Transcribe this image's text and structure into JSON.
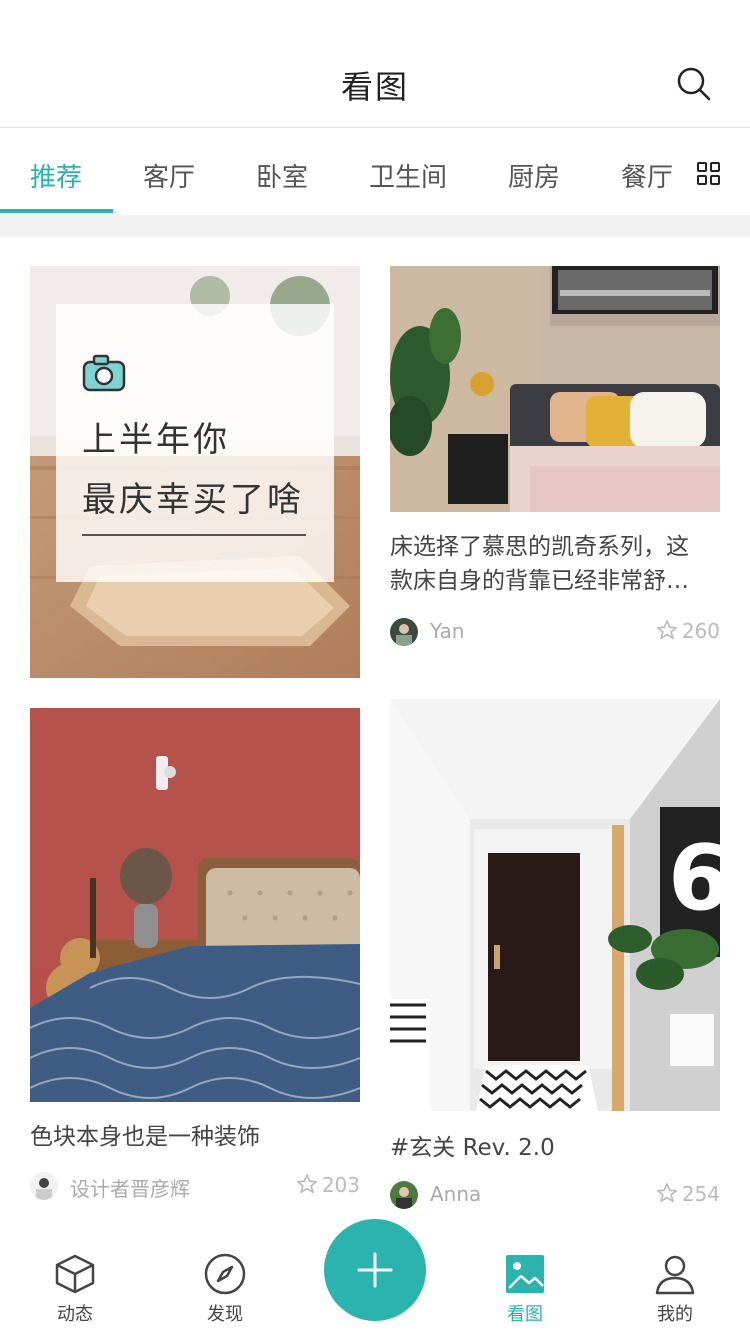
{
  "header": {
    "title": "看图",
    "search_icon": "search-icon"
  },
  "tabs": [
    {
      "label": "推荐",
      "active": true
    },
    {
      "label": "客厅"
    },
    {
      "label": "卧室"
    },
    {
      "label": "卫生间"
    },
    {
      "label": "厨房"
    },
    {
      "label": "餐厅"
    }
  ],
  "cards": [
    {
      "promo_line1": "上半年你",
      "promo_line2": "最庆幸买了啥"
    },
    {
      "caption_line1": "床选择了慕思的凯奇系列，这",
      "caption_line2": "款床自身的背靠已经非常舒…",
      "author": "Yan",
      "likes": "260"
    },
    {
      "caption": "色块本身也是一种装饰",
      "author": "设计者晋彦辉",
      "likes": "203"
    },
    {
      "caption": "#玄关 Rev. 2.0",
      "author": "Anna",
      "likes": "254"
    }
  ],
  "nav": {
    "items": [
      {
        "label": "动态",
        "icon": "cube-icon"
      },
      {
        "label": "发现",
        "icon": "compass-icon"
      },
      {
        "label": "看图",
        "icon": "image-icon",
        "active": true
      },
      {
        "label": "我的",
        "icon": "user-icon"
      }
    ],
    "fab_icon": "plus-icon"
  },
  "colors": {
    "accent": "#2bb3ae"
  }
}
